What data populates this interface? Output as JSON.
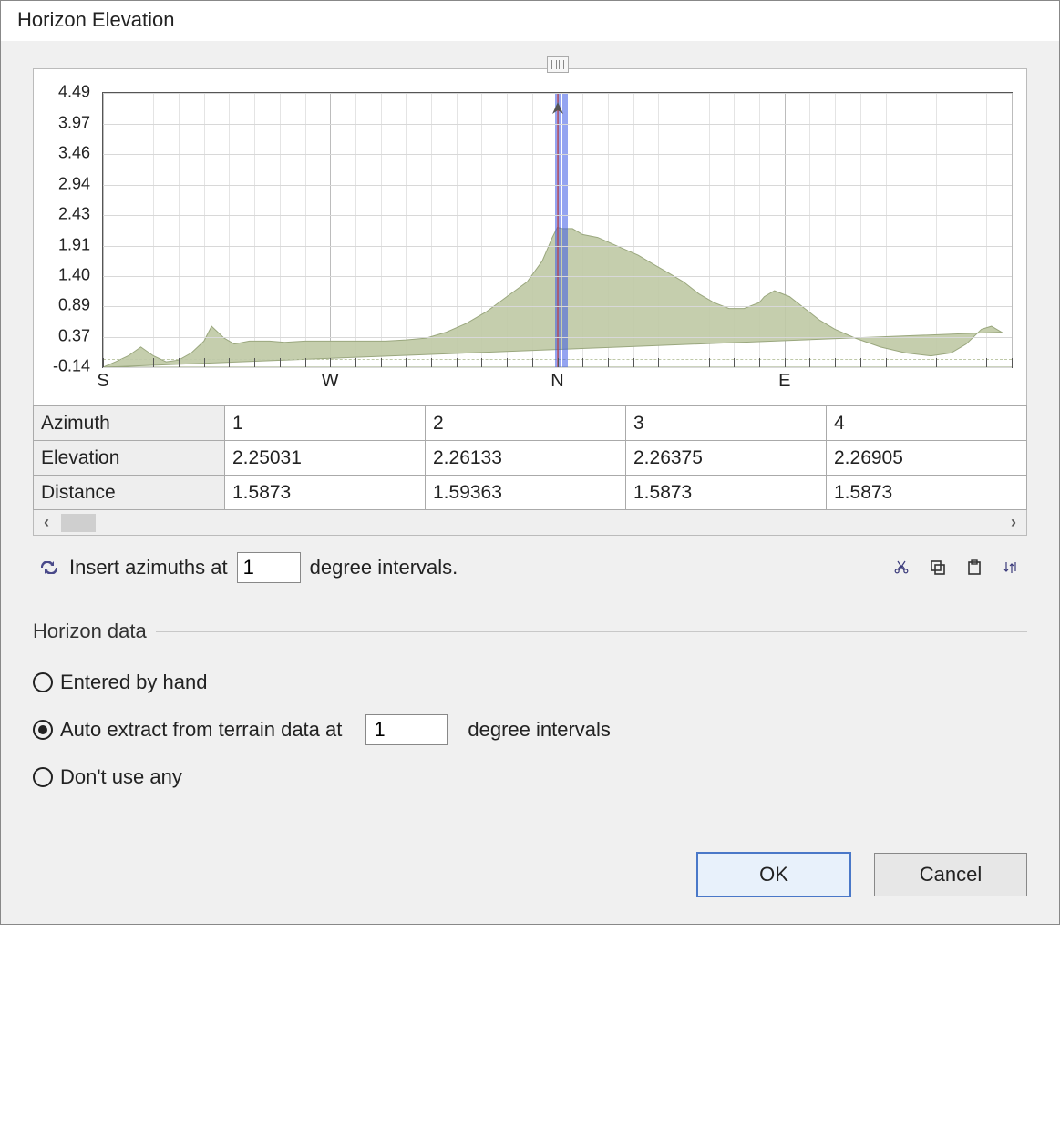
{
  "window": {
    "title": "Horizon Elevation"
  },
  "chart_data": {
    "type": "area",
    "xlabel": "",
    "ylabel": "",
    "ylim": [
      -0.14,
      4.49
    ],
    "yticks": [
      -0.14,
      0.37,
      0.89,
      1.4,
      1.91,
      2.43,
      2.94,
      3.46,
      3.97,
      4.49
    ],
    "x_major_labels": [
      "S",
      "W",
      "N",
      "E"
    ],
    "x_major_positions_deg": [
      180,
      270,
      0,
      90
    ],
    "x_range_deg_start": 180,
    "marker_deg": 0,
    "series": [
      {
        "name": "horizon-elevation",
        "x_deg": [
          180,
          185,
          190,
          195,
          200,
          205,
          210,
          215,
          220,
          223,
          228,
          232,
          238,
          246,
          252,
          260,
          268,
          276,
          284,
          292,
          300,
          308,
          316,
          324,
          332,
          340,
          348,
          354,
          358,
          0,
          2,
          6,
          10,
          16,
          24,
          32,
          38,
          44,
          50,
          56,
          62,
          68,
          74,
          80,
          82,
          86,
          92,
          98,
          104,
          110,
          118,
          128,
          138,
          148,
          156,
          162,
          168,
          172,
          176,
          180
        ],
        "y": [
          -0.14,
          -0.05,
          0.05,
          0.2,
          0.05,
          -0.05,
          -0.02,
          0.1,
          0.3,
          0.55,
          0.35,
          0.25,
          0.3,
          0.3,
          0.28,
          0.3,
          0.3,
          0.3,
          0.3,
          0.3,
          0.32,
          0.35,
          0.45,
          0.6,
          0.8,
          1.05,
          1.3,
          1.65,
          2.05,
          2.22,
          2.2,
          2.2,
          2.1,
          2.05,
          1.9,
          1.75,
          1.6,
          1.45,
          1.3,
          1.1,
          0.95,
          0.85,
          0.85,
          0.95,
          1.05,
          1.15,
          1.05,
          0.85,
          0.65,
          0.5,
          0.35,
          0.2,
          0.1,
          0.05,
          0.1,
          0.25,
          0.5,
          0.55,
          0.45,
          -0.14
        ]
      }
    ]
  },
  "table": {
    "row_headers": [
      "Azimuth",
      "Elevation",
      "Distance"
    ],
    "columns_visible": [
      {
        "azimuth": "1",
        "elevation": "2.25031",
        "distance": "1.5873"
      },
      {
        "azimuth": "2",
        "elevation": "2.26133",
        "distance": "1.59363"
      },
      {
        "azimuth": "3",
        "elevation": "2.26375",
        "distance": "1.5873"
      },
      {
        "azimuth": "4",
        "elevation": "2.26905",
        "distance": "1.5873"
      }
    ]
  },
  "insert_row": {
    "prefix": "Insert azimuths at",
    "value": "1",
    "suffix": "degree intervals.",
    "refresh_icon": "refresh-icon",
    "tool_icons": [
      "cut-icon",
      "copy-icon",
      "paste-icon",
      "sort-icon"
    ]
  },
  "group": {
    "title": "Horizon data",
    "radio_options": [
      {
        "key": "hand",
        "label": "Entered by hand",
        "checked": false
      },
      {
        "key": "auto",
        "label_before": "Auto extract from terrain data at",
        "value": "1",
        "label_after": "degree intervals",
        "checked": true
      },
      {
        "key": "none",
        "label": "Don't use any",
        "checked": false
      }
    ]
  },
  "buttons": {
    "ok": "OK",
    "cancel": "Cancel"
  }
}
